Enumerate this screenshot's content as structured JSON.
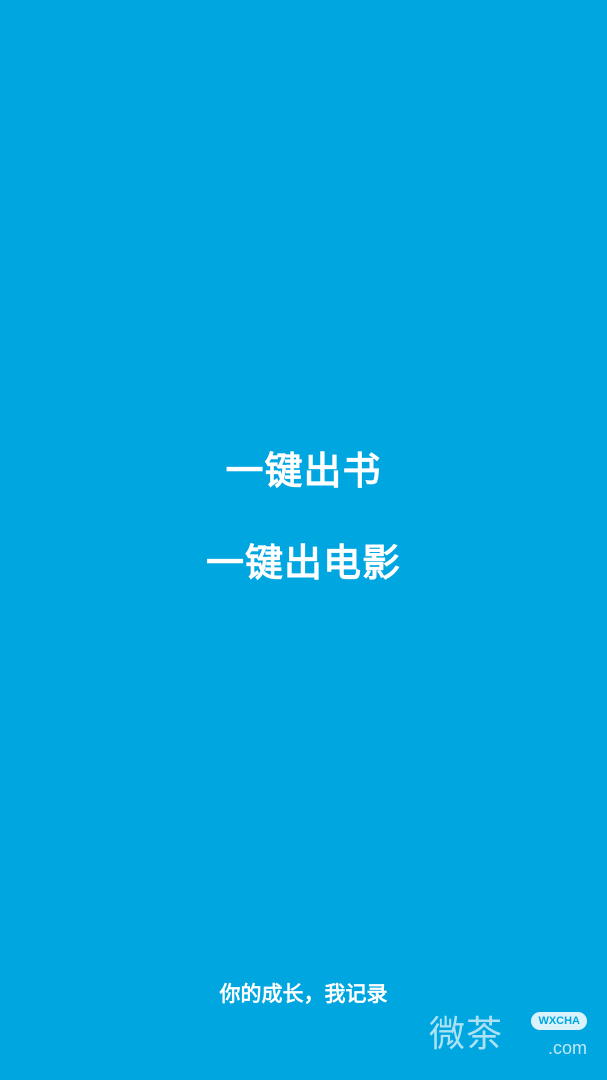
{
  "theme": {
    "background": "#00A6E0",
    "text": "#FFFFFF"
  },
  "splash": {
    "headline_line1": "一键出书",
    "headline_line2": "一键出电影",
    "tagline": "你的成长，我记录"
  },
  "watermark": {
    "mark_text": "微茶",
    "badge_text": "WXCHA",
    "domain_text": ".com"
  }
}
